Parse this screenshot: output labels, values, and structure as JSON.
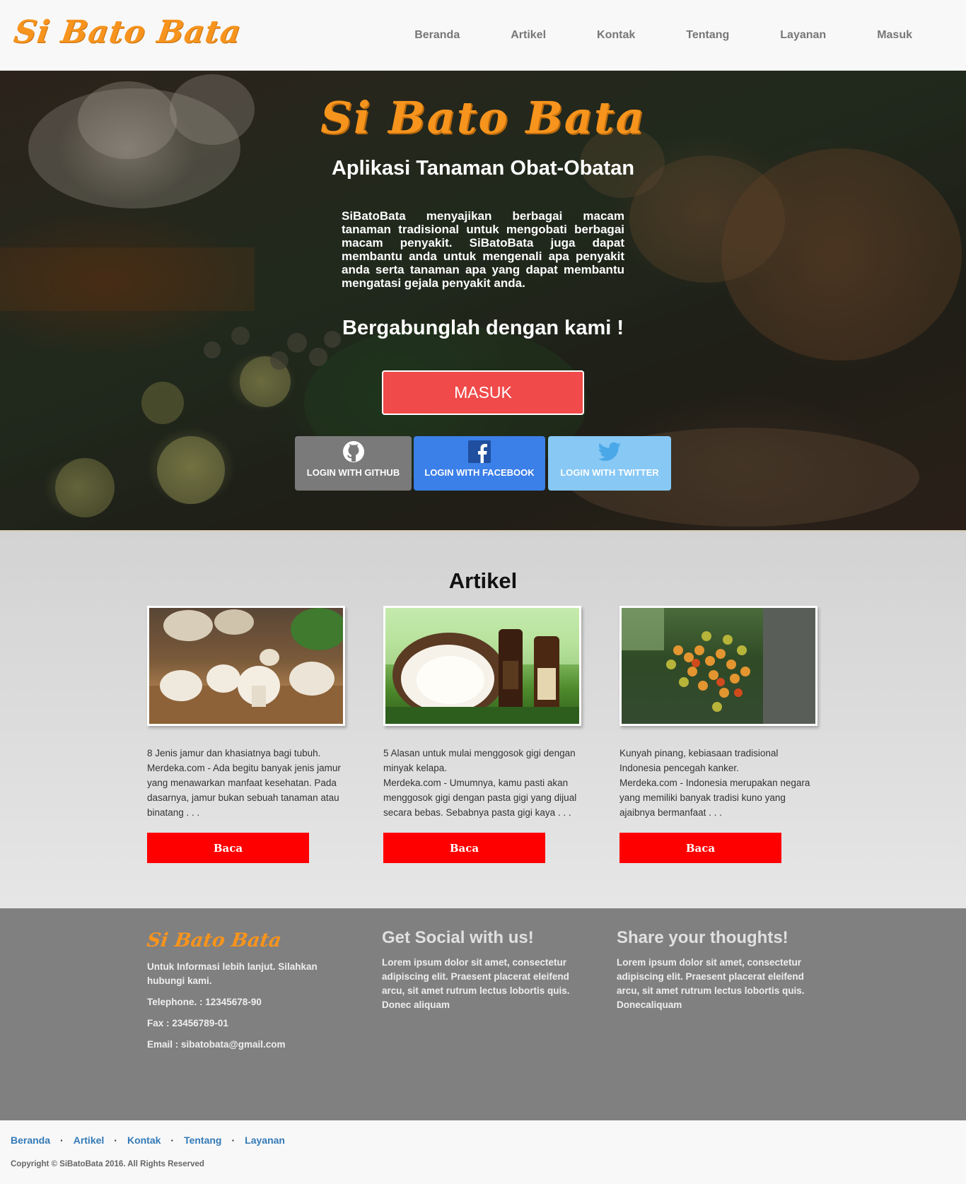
{
  "nav": {
    "brand": "Si Bato Bata",
    "links": [
      "Beranda",
      "Artikel",
      "Kontak",
      "Tentang",
      "Layanan",
      "Masuk"
    ]
  },
  "hero": {
    "title": "Si Bato Bata",
    "subtitle": "Aplikasi Tanaman Obat-Obatan",
    "description": "SiBatoBata menyajikan berbagai macam tanaman tradisional untuk mengobati berbagai macam penyakit. SiBatoBata juga dapat membantu anda untuk mengenali apa penyakit anda serta tanaman apa yang dapat membantu mengatasi gejala penyakit anda.",
    "join": "Bergabunglah dengan kami !",
    "login_button": "MASUK",
    "social": {
      "github": "LOGIN WITH GITHUB",
      "facebook": "LOGIN WITH FACEBOOK",
      "twitter": "LOGIN WITH TWITTER"
    },
    "colors": {
      "brand": "#f7941d",
      "login": "#f04a4a",
      "github": "#7a7a7a",
      "facebook": "#3b7fe8",
      "twitter": "#87c8f5"
    }
  },
  "articles": {
    "title": "Artikel",
    "items": [
      {
        "headline": "8 Jenis jamur dan khasiatnya bagi tubuh.",
        "excerpt": "Merdeka.com - Ada begitu banyak jenis jamur yang menawarkan manfaat kesehatan. Pada dasarnya, jamur bukan sebuah tanaman atau binatang . . .",
        "button": "Baca"
      },
      {
        "headline": "5 Alasan untuk mulai menggosok gigi dengan minyak kelapa.",
        "excerpt": "Merdeka.com - Umumnya, kamu pasti akan menggosok gigi dengan pasta gigi yang dijual secara bebas. Sebabnya pasta gigi kaya . . .",
        "button": "Baca"
      },
      {
        "headline": "Kunyah pinang, kebiasaan tradisional Indonesia pencegah kanker.",
        "excerpt": "Merdeka.com - Indonesia merupakan negara yang memiliki banyak tradisi kuno yang ajaibnya bermanfaat . . .",
        "button": "Baca"
      }
    ]
  },
  "footer": {
    "brand": "Si Bato Bata",
    "contact_intro": "Untuk Informasi lebih lanjut. Silahkan hubungi kami.",
    "telephone": "Telephone. : 12345678-90",
    "fax": "Fax : 23456789-01",
    "email": "Email : sibatobata@gmail.com",
    "social_heading": "Get Social with us!",
    "social_text": "Lorem ipsum dolor sit amet, consectetur adipiscing elit. Praesent placerat eleifend arcu, sit amet rutrum lectus lobortis quis. Donec aliquam",
    "thoughts_heading": "Share your thoughts!",
    "thoughts_text": "Lorem ipsum dolor sit amet, consectetur adipiscing elit. Praesent placerat eleifend arcu, sit amet rutrum lectus lobortis quis. Donecaliquam"
  },
  "bottom": {
    "links": [
      "Beranda",
      "Artikel",
      "Kontak",
      "Tentang",
      "Layanan"
    ],
    "copyright": "Copyright © SiBatoBata 2016. All Rights Reserved"
  }
}
